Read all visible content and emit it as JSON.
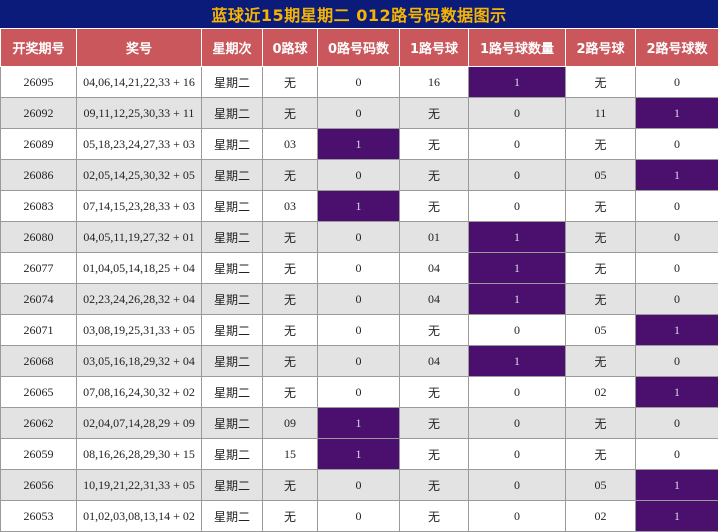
{
  "title": "蓝球近15期星期二 012路号码数据图示",
  "headers": [
    "开奖期号",
    "奖号",
    "星期次",
    "0路球",
    "0路号码数",
    "1路号球",
    "1路号球数量",
    "2路号球",
    "2路号球数"
  ],
  "rows": [
    [
      "26095",
      "04,06,14,21,22,33 + 16",
      "星期二",
      "无",
      "0",
      "16",
      "1",
      "无",
      "0"
    ],
    [
      "26092",
      "09,11,12,25,30,33 + 11",
      "星期二",
      "无",
      "0",
      "无",
      "0",
      "11",
      "1"
    ],
    [
      "26089",
      "05,18,23,24,27,33 + 03",
      "星期二",
      "03",
      "1",
      "无",
      "0",
      "无",
      "0"
    ],
    [
      "26086",
      "02,05,14,25,30,32 + 05",
      "星期二",
      "无",
      "0",
      "无",
      "0",
      "05",
      "1"
    ],
    [
      "26083",
      "07,14,15,23,28,33 + 03",
      "星期二",
      "03",
      "1",
      "无",
      "0",
      "无",
      "0"
    ],
    [
      "26080",
      "04,05,11,19,27,32 + 01",
      "星期二",
      "无",
      "0",
      "01",
      "1",
      "无",
      "0"
    ],
    [
      "26077",
      "01,04,05,14,18,25 + 04",
      "星期二",
      "无",
      "0",
      "04",
      "1",
      "无",
      "0"
    ],
    [
      "26074",
      "02,23,24,26,28,32 + 04",
      "星期二",
      "无",
      "0",
      "04",
      "1",
      "无",
      "0"
    ],
    [
      "26071",
      "03,08,19,25,31,33 + 05",
      "星期二",
      "无",
      "0",
      "无",
      "0",
      "05",
      "1"
    ],
    [
      "26068",
      "03,05,16,18,29,32 + 04",
      "星期二",
      "无",
      "0",
      "04",
      "1",
      "无",
      "0"
    ],
    [
      "26065",
      "07,08,16,24,30,32 + 02",
      "星期二",
      "无",
      "0",
      "无",
      "0",
      "02",
      "1"
    ],
    [
      "26062",
      "02,04,07,14,28,29 + 09",
      "星期二",
      "09",
      "1",
      "无",
      "0",
      "无",
      "0"
    ],
    [
      "26059",
      "08,16,26,28,29,30 + 15",
      "星期二",
      "15",
      "1",
      "无",
      "0",
      "无",
      "0"
    ],
    [
      "26056",
      "10,19,21,22,31,33 + 05",
      "星期二",
      "无",
      "0",
      "无",
      "0",
      "05",
      "1"
    ],
    [
      "26053",
      "01,02,03,08,13,14 + 02",
      "星期二",
      "无",
      "0",
      "无",
      "0",
      "02",
      "1"
    ]
  ],
  "colors": {
    "title_bg": "#0a1b7a",
    "title_text": "#f5b400",
    "header_bg": "#c9575b",
    "highlight": "#4b0f6e",
    "row_alt": "#e3e3e3"
  }
}
